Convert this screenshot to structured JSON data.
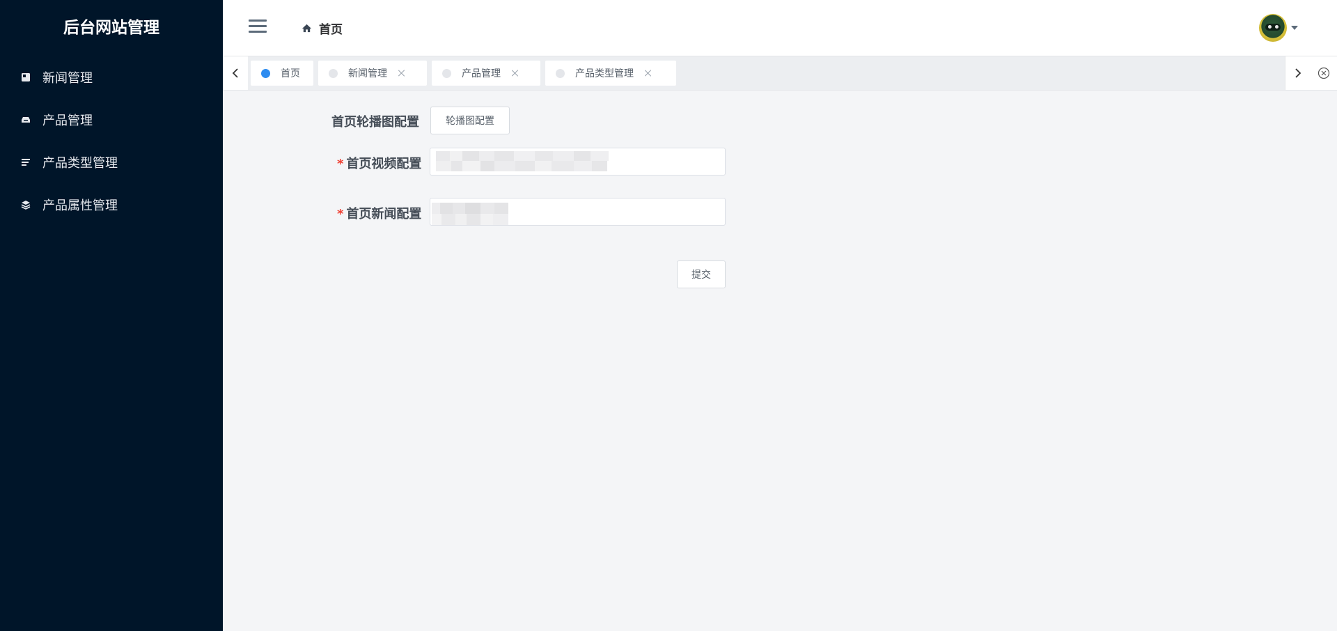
{
  "sidebar": {
    "title": "后台网站管理",
    "items": [
      {
        "label": "新闻管理",
        "icon": "book-icon"
      },
      {
        "label": "产品管理",
        "icon": "inbox-icon"
      },
      {
        "label": "产品类型管理",
        "icon": "list-icon"
      },
      {
        "label": "产品属性管理",
        "icon": "layers-icon"
      }
    ]
  },
  "header": {
    "breadcrumb": "首页"
  },
  "tabs": [
    {
      "label": "首页",
      "active": true
    },
    {
      "label": "新闻管理",
      "active": false
    },
    {
      "label": "产品管理",
      "active": false
    },
    {
      "label": "产品类型管理",
      "active": false
    }
  ],
  "form": {
    "carousel_label": "首页轮播图配置",
    "carousel_button": "轮播图配置",
    "video_label": "首页视频配置",
    "video_value": "",
    "news_label": "首页新闻配置",
    "news_value": "",
    "submit_label": "提交"
  },
  "colors": {
    "sidebar_bg": "#001529",
    "accent": "#2d8cf0",
    "required": "#f04134"
  }
}
